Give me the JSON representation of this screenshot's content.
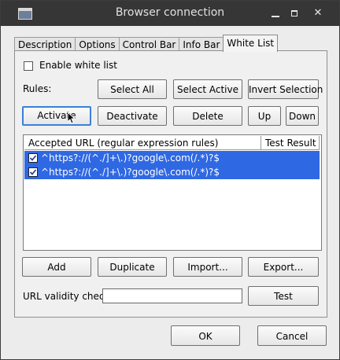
{
  "window": {
    "title": "Browser connection",
    "minimize_icon": "minimize-icon",
    "maximize_icon": "maximize-icon",
    "close_icon": "close-icon"
  },
  "tabs": [
    "Description",
    "Options",
    "Control Bar",
    "Info Bar",
    "White List"
  ],
  "active_tab": "White List",
  "enable_white_list": {
    "label": "Enable white list",
    "checked": false
  },
  "rules": {
    "label": "Rules:",
    "select_all": "Select All",
    "select_active": "Select Active",
    "invert_selection": "Invert Selection",
    "activate": "Activate",
    "deactivate": "Deactivate",
    "delete": "Delete",
    "up": "Up",
    "down": "Down"
  },
  "list": {
    "columns": [
      "Accepted URL (regular expression rules)",
      "Test Result"
    ],
    "rows": [
      {
        "checked": true,
        "url": "^https?://(^./]+\\.)?google\\.com(/.*)?$",
        "result": ""
      },
      {
        "checked": true,
        "url": "^https?://(^./]+\\.)?google\\.com(/.*)?$",
        "result": ""
      }
    ]
  },
  "actions": {
    "add": "Add",
    "duplicate": "Duplicate",
    "import": "Import...",
    "export": "Export..."
  },
  "url_check": {
    "label": "URL validity check",
    "value": "",
    "placeholder": "",
    "test": "Test"
  },
  "dialog": {
    "ok": "OK",
    "cancel": "Cancel"
  },
  "colors": {
    "selection": "#2f68e3",
    "focus": "#3a80d9",
    "titlebar": "#363636"
  }
}
